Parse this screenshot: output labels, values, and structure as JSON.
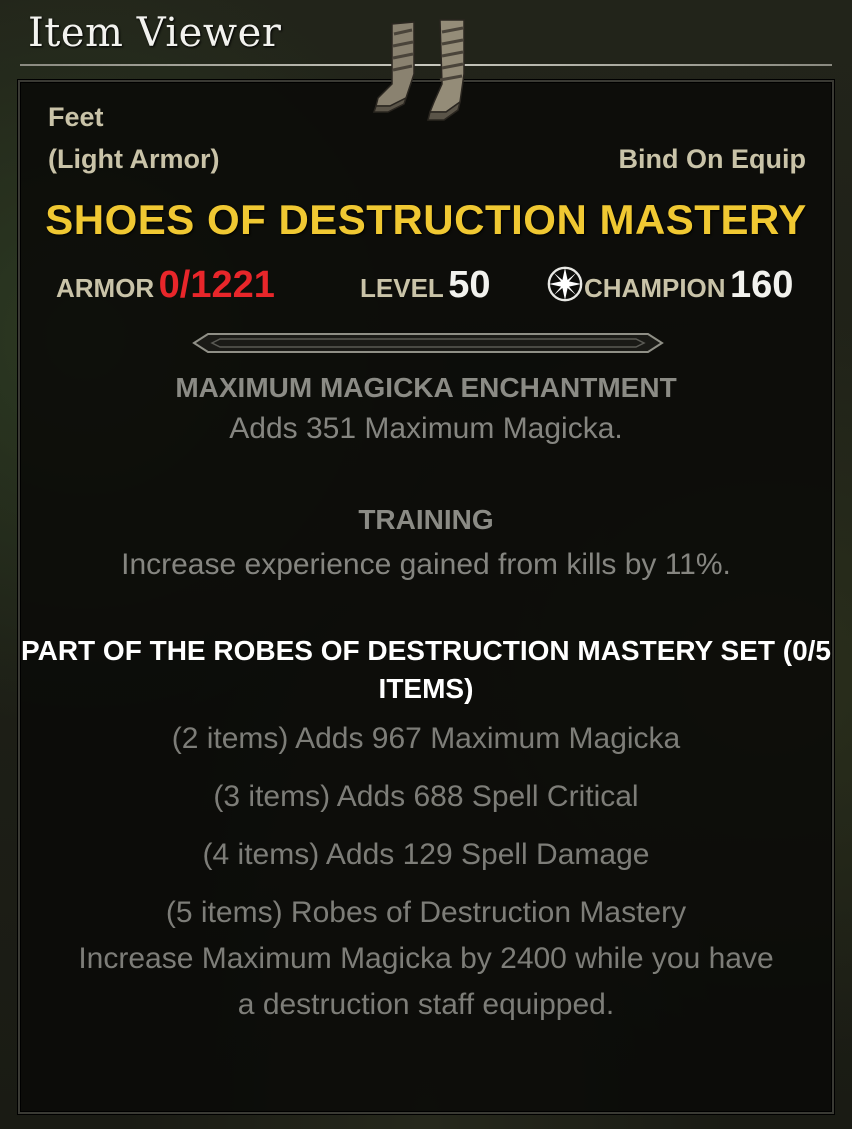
{
  "window": {
    "title": "Item Viewer"
  },
  "item": {
    "slot": "Feet",
    "type": "(Light Armor)",
    "bind": "Bind On Equip",
    "name": "SHOES OF DESTRUCTION MASTERY",
    "icon": "boots-icon"
  },
  "stats": {
    "armor_label": "ARMOR",
    "armor_value": "0/1221",
    "level_label": "LEVEL",
    "level_value": "50",
    "champion_label": "CHAMPION",
    "champion_value": "160",
    "champion_icon": "champion-star-icon"
  },
  "enchantment": {
    "heading": "MAXIMUM MAGICKA ENCHANTMENT",
    "text": "Adds 351 Maximum Magicka."
  },
  "trait": {
    "heading": "TRAINING",
    "text": "Increase experience gained from kills by 11%."
  },
  "set": {
    "heading_line1": "PART OF THE ROBES OF DESTRUCTION MASTERY SET (0/5",
    "heading_line2": "ITEMS)",
    "bonuses": [
      "(2 items) Adds 967 Maximum Magicka",
      "(3 items) Adds 688 Spell Critical",
      "(4 items) Adds 129 Spell Damage",
      "(5 items) Robes of Destruction Mastery",
      "Increase Maximum Magicka by 2400 while you have",
      "a destruction staff equipped."
    ]
  },
  "colors": {
    "item_name": "#f0c832",
    "armor_value": "#e8262a",
    "label": "#c9c3a8",
    "body_text": "#858580"
  }
}
